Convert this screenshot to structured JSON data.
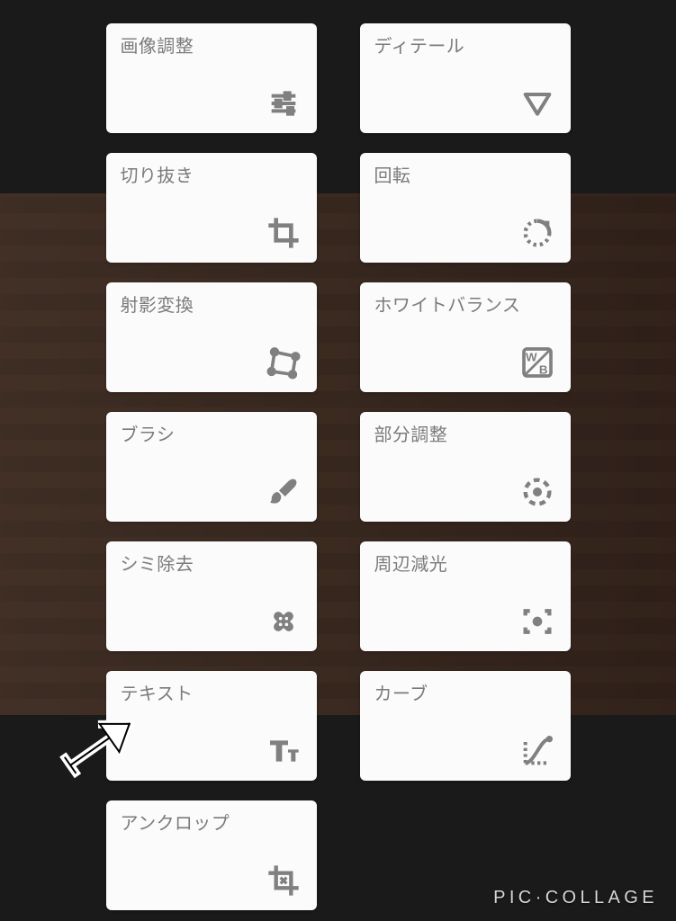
{
  "tools": {
    "tune": {
      "label": "画像調整",
      "icon": "tune-icon"
    },
    "details": {
      "label": "ディテール",
      "icon": "triangle-down-icon"
    },
    "crop": {
      "label": "切り抜き",
      "icon": "crop-icon"
    },
    "rotate": {
      "label": "回転",
      "icon": "rotate-icon"
    },
    "transform": {
      "label": "射影変換",
      "icon": "perspective-icon"
    },
    "wb": {
      "label": "ホワイトバランス",
      "icon": "wb-icon"
    },
    "brush": {
      "label": "ブラシ",
      "icon": "brush-icon"
    },
    "selective": {
      "label": "部分調整",
      "icon": "selective-icon"
    },
    "healing": {
      "label": "シミ除去",
      "icon": "healing-icon"
    },
    "vignette": {
      "label": "周辺減光",
      "icon": "vignette-icon"
    },
    "text": {
      "label": "テキスト",
      "icon": "text-icon"
    },
    "curves": {
      "label": "カーブ",
      "icon": "curves-icon"
    },
    "uncrop": {
      "label": "アンクロップ",
      "icon": "uncrop-icon"
    }
  },
  "watermark": "PIC·COLLAGE"
}
